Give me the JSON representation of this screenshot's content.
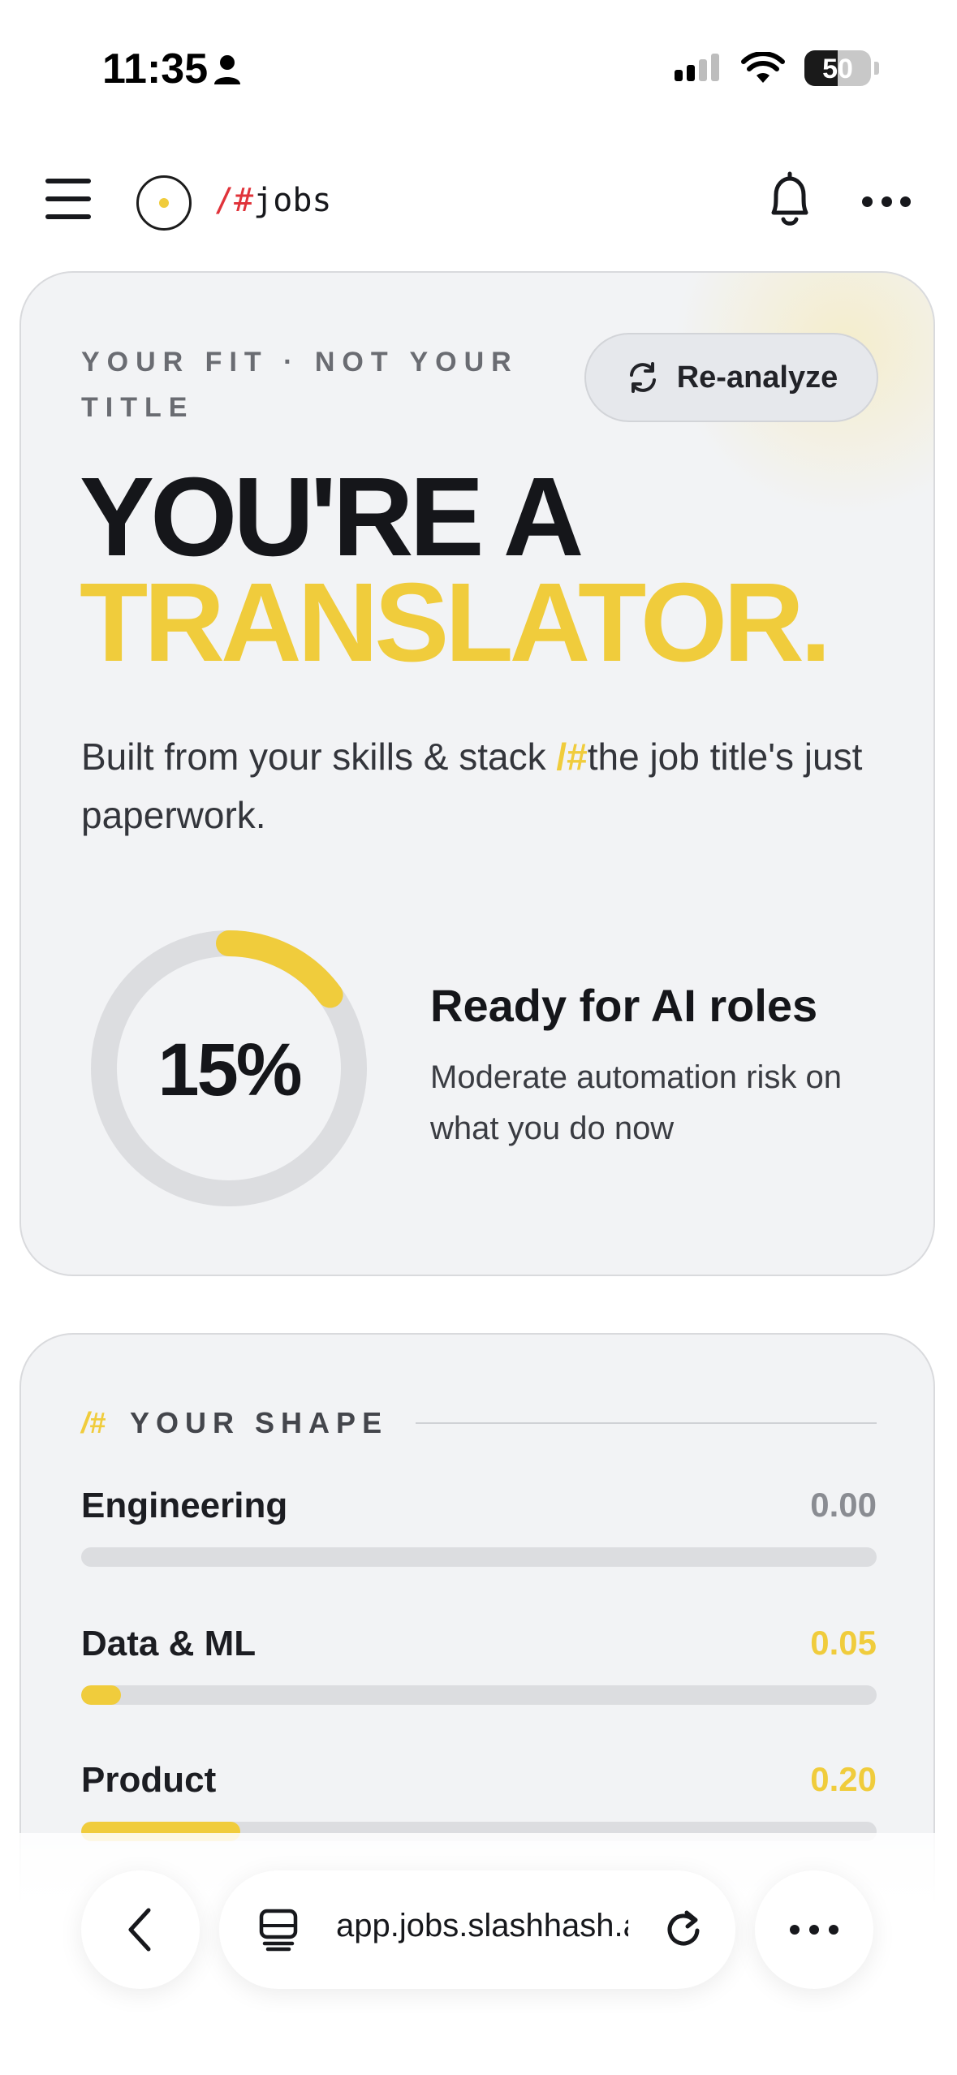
{
  "status_bar": {
    "time": "11:35",
    "battery": "50",
    "battery_level": 0.5
  },
  "header": {
    "brand_mark": "/#",
    "brand_name": "jobs"
  },
  "hero": {
    "eyebrow": "YOUR FIT · NOT YOUR TITLE",
    "reanalyze_label": "Re-analyze",
    "headline_line1": "YOU'RE A",
    "headline_line2": "TRANSLATOR.",
    "subtitle_before": "Built from your skills & stack ",
    "subtitle_accent": "/#",
    "subtitle_after": "the job title's just paperwork.",
    "ring_value": "15%",
    "ring_fraction": 0.15,
    "ready_title": "Ready for AI roles",
    "ready_subtitle": "Moderate automation risk on what you do now"
  },
  "shape": {
    "mark": "/#",
    "title": "YOUR SHAPE",
    "rows": [
      {
        "label": "Engineering",
        "value": "0.00",
        "level": 0.0,
        "value_color": "#8a8c92"
      },
      {
        "label": "Data & ML",
        "value": "0.05",
        "level": 0.05,
        "value_color": "#f0cc3c"
      },
      {
        "label": "Product",
        "value": "0.20",
        "level": 0.2,
        "value_color": "#f0cc3c"
      }
    ]
  },
  "browser": {
    "url": "app.jobs.slashhash.ai"
  },
  "colors": {
    "accent": "#f0cc3c",
    "brand_red": "#e0333a",
    "card_bg": "#f2f3f5"
  }
}
